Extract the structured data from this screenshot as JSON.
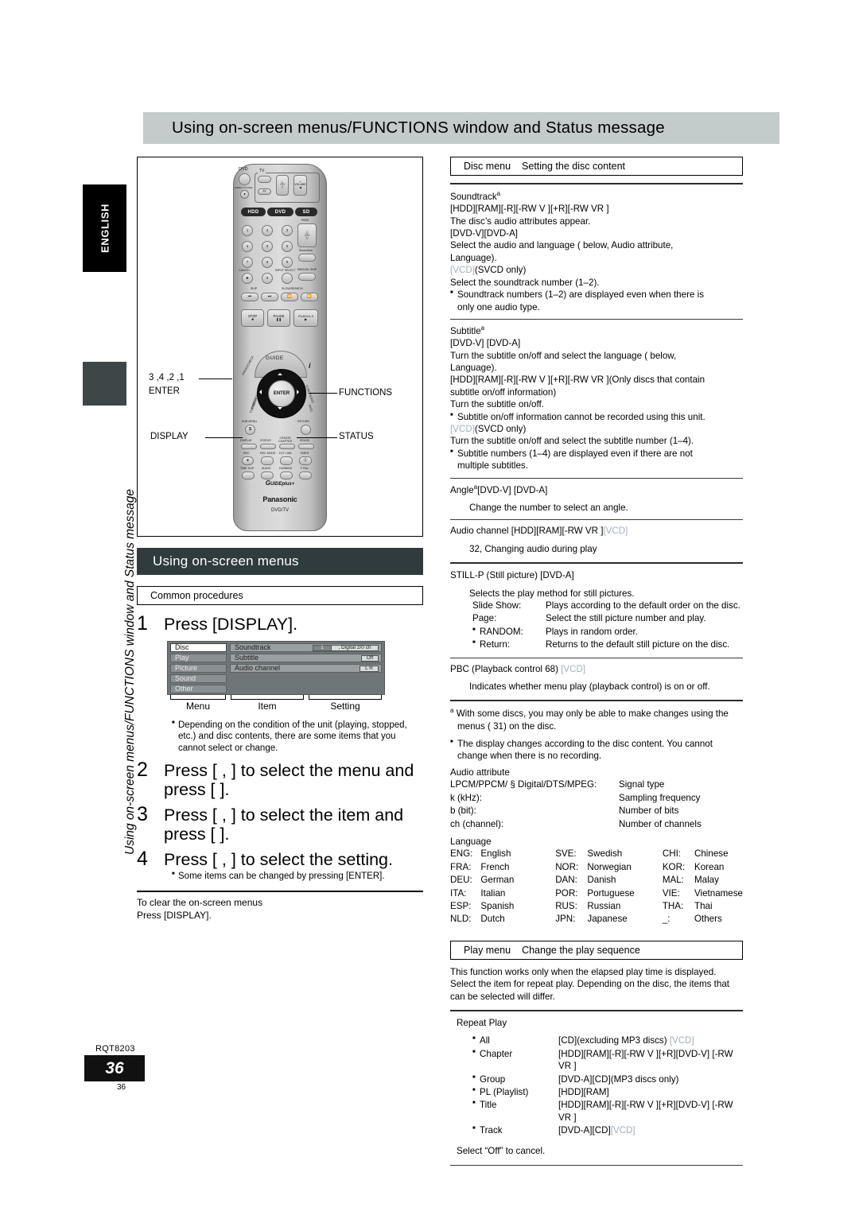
{
  "page": {
    "banner_title": "Using on-screen menus/FUNCTIONS window and Status message",
    "language_tab": "ENGLISH",
    "vertical_label": "Using on-screen menus/FUNCTIONS window and Status message",
    "doc_code": "RQT8203",
    "page_number": "36",
    "page_number_small": "36"
  },
  "remote": {
    "brand": "Panasonic",
    "model_line": "DVD/TV",
    "guide_plus": "GUIDE plus+",
    "guide_plus_sub": "GEMSTAR",
    "top_labels": {
      "dvd": "DVD",
      "tv": "TV",
      "direct_tv_rec": "DIRECT TV REC",
      "av": "AV",
      "ch": "CH",
      "volume": "VOLUME"
    },
    "mode_buttons": [
      "HDD",
      "DVD",
      "SD"
    ],
    "numeric": [
      "1",
      "2",
      "3",
      "4",
      "5",
      "6",
      "7",
      "8",
      "9",
      "0"
    ],
    "page_label": "PAGE",
    "ch_label": "CH",
    "showview": "ShowView",
    "cancel": "CANCEL",
    "cancel_glyph": "✱",
    "input_select": "INPUT SELECT",
    "manual_skip": "MANUAL SKIP",
    "skip_label": "SKIP",
    "slow_search_label": "SLOW/SEARCH",
    "transport": [
      "STOP",
      "PAUSE",
      "PLAY/x1.3"
    ],
    "guide": "GUIDE",
    "enter": "ENTER",
    "sub_menu": "SUB MENU",
    "sub_menu_glyph": "S",
    "return": "RETURN",
    "row_display": [
      "DISPLAY",
      "STATUS",
      "CREATE CHAPTER",
      "ERASE"
    ],
    "row_rec": [
      "REC",
      "REC MODE",
      "EXT LINK",
      "TIMER"
    ],
    "row_bottom": [
      "TIME SLIP",
      "AUDIO",
      "DUBBING",
      "F Rec"
    ],
    "left_tilt": [
      "PROG/CHECK",
      "DIRECT NAVIGATOR",
      "TOP MENU"
    ],
    "right_tilt": [
      "FUNCTIONS",
      "DISC"
    ],
    "info_glyph": "i"
  },
  "callouts": {
    "dpad": "3 ,4 ,2 ,1",
    "enter": "ENTER",
    "functions": "FUNCTIONS",
    "display": "DISPLAY",
    "status": "STATUS"
  },
  "left": {
    "section_title": "Using on-screen menus",
    "common_procedures": "Common procedures",
    "steps": [
      {
        "num": "1",
        "line1": "Press [DISPLAY].",
        "line2": ""
      },
      {
        "num": "2",
        "line1": "Press [  ,   ] to select the menu and",
        "line2": "press [  ]."
      },
      {
        "num": "3",
        "line1": "Press [  ,   ] to select the item and",
        "line2": "press [  ]."
      },
      {
        "num": "4",
        "line1": "Press [  ,   ] to select the setting.",
        "line2": ""
      }
    ],
    "osd": {
      "menu_items": [
        "Disc",
        "Play",
        "Picture",
        "Sound",
        "Other"
      ],
      "rows": [
        {
          "label": "Soundtrack",
          "value2": "1",
          "value": ",  Digital  2/0 ch"
        },
        {
          "label": "Subtitle",
          "value": "Off"
        },
        {
          "label": "Audio channel",
          "value": "L R"
        }
      ],
      "captions": [
        "Menu",
        "Item",
        "Setting"
      ]
    },
    "note_step1": {
      "l1": "Depending on the condition of the unit (playing, stopped,",
      "l2": "etc.) and disc contents, there are some items that you",
      "l3": "cannot select or change."
    },
    "note_step4": "Some items can be changed by pressing [ENTER].",
    "tail_title": "To clear the on-screen menus",
    "tail_body": "Press [DISPLAY]."
  },
  "right": {
    "disc_menu": {
      "title": "Disc menu",
      "subtitle": "Setting the disc content"
    },
    "soundtrack": {
      "head": "Soundtrack",
      "head_sup": "a",
      "l1": "[HDD][RAM][-R][-RW V ][+R][-RW VR ]",
      "l2": "The disc’s audio attributes appear.",
      "l3": "[DVD-V][DVD-A]",
      "l4": "Select the audio and language (    below, Audio attribute,",
      "l5": "Language).",
      "l6_vcd": "[VCD]",
      "l6_rest": "(SVCD only)",
      "l7": "Select the soundtrack number (1–2).",
      "b1": "Soundtrack numbers (1–2) are displayed even when there is",
      "b1b": "only one audio type."
    },
    "subtitle": {
      "head": "Subtitle",
      "head_sup": "a",
      "l1": "[DVD-V] [DVD-A]",
      "l2": "Turn the subtitle on/off and select the language (    below,",
      "l3": "Language).",
      "l4": "[HDD][RAM][-R][-RW V ][+R][-RW VR ](Only discs that contain",
      "l5": "subtitle on/off information)",
      "l6": "Turn the subtitle on/off.",
      "b1": "Subtitle on/off information cannot be recorded using this unit.",
      "l7_vcd": "[VCD]",
      "l7_rest": "(SVCD only)",
      "l8": "Turn the subtitle on/off and select the subtitle number (1–4).",
      "b2": "Subtitle numbers (1–4) are displayed even if there are not",
      "b2b": "multiple subtitles."
    },
    "angle": {
      "head": "Angle",
      "head_sup": "a",
      "head_rest": "[DVD-V] [DVD-A]",
      "body": "Change the number to select an angle."
    },
    "audio_channel": {
      "head": "Audio channel ",
      "head_discs": "[HDD][RAM][-RW VR ]",
      "head_vcd": "[VCD]",
      "body": "32, Changing audio during play"
    },
    "still_p": {
      "head": "STILL-P (Still picture) [DVD-A]",
      "intro": "Selects the play method for still pictures.",
      "rows": [
        {
          "k": "Slide Show:",
          "v": "Plays according to the default order on the disc.",
          "bullet": false
        },
        {
          "k": "Page:",
          "v": "Select the still picture number and play.",
          "bullet": false
        },
        {
          "k": "RANDOM:",
          "v": "Plays in random order.",
          "bullet": true
        },
        {
          "k": "Return:",
          "v": "Returns to the default still picture on the disc.",
          "bullet": true
        }
      ]
    },
    "pbc": {
      "head": "PBC (Playback control    68) ",
      "head_vcd": "[VCD]",
      "body": "Indicates whether menu play (playback control) is on or off."
    },
    "footnote_a": {
      "sup": "a",
      "l1": "With some discs, you may only be able to make changes using the",
      "l2": "menus (   31) on the disc."
    },
    "footnote_b": {
      "l1": "The display changes according to the disc content. You cannot",
      "l2": "change when there is no recording."
    },
    "audio_attribute": {
      "title": "Audio attribute",
      "rows": [
        {
          "k": "LPCM/PPCM/ §  Digital/DTS/MPEG:",
          "v": "Signal type"
        },
        {
          "k": "k (kHz):",
          "v": "Sampling frequency"
        },
        {
          "k": "b (bit):",
          "v": "Number of bits"
        },
        {
          "k": "ch (channel):",
          "v": "Number of channels"
        }
      ]
    },
    "language": {
      "title": "Language",
      "rows": [
        [
          "ENG:",
          "English",
          "SVE:",
          "Swedish",
          "CHI:",
          "Chinese"
        ],
        [
          "FRA:",
          "French",
          "NOR:",
          "Norwegian",
          "KOR:",
          "Korean"
        ],
        [
          "DEU:",
          "German",
          "DAN:",
          "Danish",
          "MAL:",
          "Malay"
        ],
        [
          "ITA:",
          "Italian",
          "POR:",
          "Portuguese",
          "VIE:",
          "Vietnamese"
        ],
        [
          "ESP:",
          "Spanish",
          "RUS:",
          "Russian",
          "THA:",
          "Thai"
        ],
        [
          "NLD:",
          "Dutch",
          "JPN:",
          "Japanese",
          "_:",
          "Others"
        ]
      ]
    },
    "play_menu": {
      "title": "Play menu",
      "subtitle": "Change the play sequence",
      "intro1": "This function works only when the elapsed play time is displayed.",
      "intro2": "Select the item for repeat play. Depending on the disc, the items that",
      "intro3": "can be selected will differ.",
      "repeat_head": "Repeat Play",
      "rows": [
        {
          "k": "All",
          "v": "[CD](excluding MP3 discs) ",
          "vcd": "[VCD]"
        },
        {
          "k": "Chapter",
          "v": "[HDD][RAM][-R][-RW V ][+R][DVD-V] [-RW VR ]",
          "vcd": ""
        },
        {
          "k": "Group",
          "v": "[DVD-A][CD](MP3 discs only)",
          "vcd": ""
        },
        {
          "k": "PL (Playlist)",
          "v": "[HDD][RAM]",
          "vcd": ""
        },
        {
          "k": "Title",
          "v": "[HDD][RAM][-R][-RW V ][+R][DVD-V] [-RW VR ]",
          "vcd": ""
        },
        {
          "k": "Track",
          "v": "[DVD-A][CD]",
          "vcd": "[VCD]"
        }
      ],
      "cancel_note": "Select “Off” to cancel."
    }
  }
}
